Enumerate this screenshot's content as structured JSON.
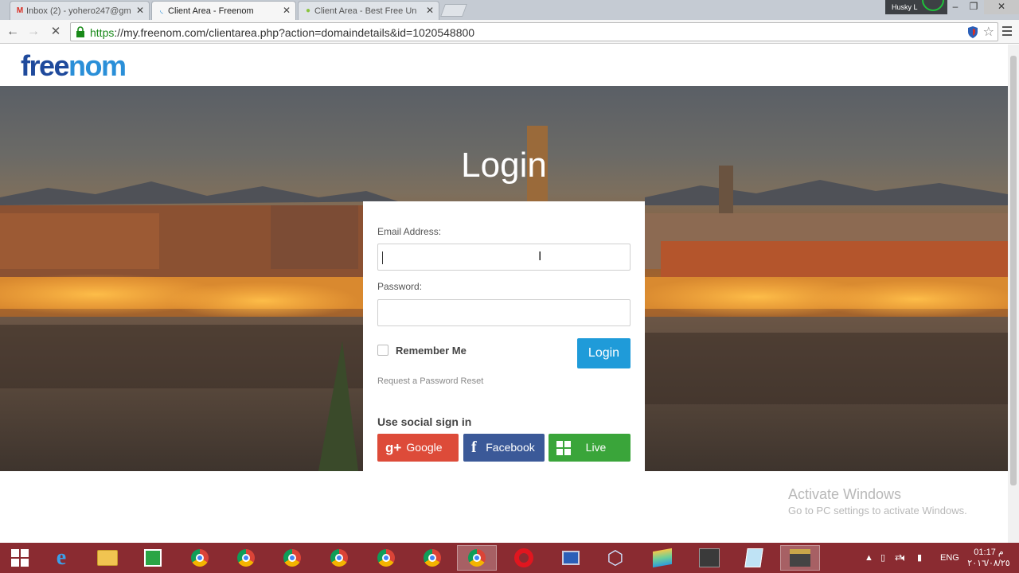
{
  "browser": {
    "tabs": [
      {
        "label": "Inbox (2) - yohero247@gm",
        "active": false
      },
      {
        "label": "Client Area - Freenom",
        "active": true
      },
      {
        "label": "Client Area - Best Free Un",
        "active": false
      }
    ],
    "profile_name": "Husky L",
    "url_scheme": "https",
    "url_rest": "://my.freenom.com/clientarea.php?action=domaindetails&id=1020548800"
  },
  "page": {
    "logo_part1": "free",
    "logo_part2": "nom",
    "login_title": "Login",
    "email_label": "Email Address:",
    "email_value": "",
    "password_label": "Password:",
    "password_value": "",
    "remember_label": "Remember Me",
    "remember_checked": false,
    "login_button": "Login",
    "reset_link": "Request a Password Reset",
    "social_title": "Use social sign in",
    "social": [
      {
        "label": "Google",
        "icon": "g+",
        "color": "#dd4b39"
      },
      {
        "label": "Facebook",
        "icon": "f",
        "color": "#3b5998"
      },
      {
        "label": "Live",
        "icon": "windows-logo",
        "color": "#3aa53a"
      }
    ]
  },
  "watermark": {
    "line1": "Activate Windows",
    "line2": "Go to PC settings to activate Windows."
  },
  "taskbar": {
    "language": "ENG",
    "time": "01:17",
    "time_suffix": "م",
    "date": "٢٠١٦/٠٨/٢٥"
  },
  "colors": {
    "accent_blue": "#1f9bd9",
    "logo_dark": "#1f4a9c",
    "logo_light": "#2a8fd8",
    "taskbar": "#8a2b31"
  }
}
